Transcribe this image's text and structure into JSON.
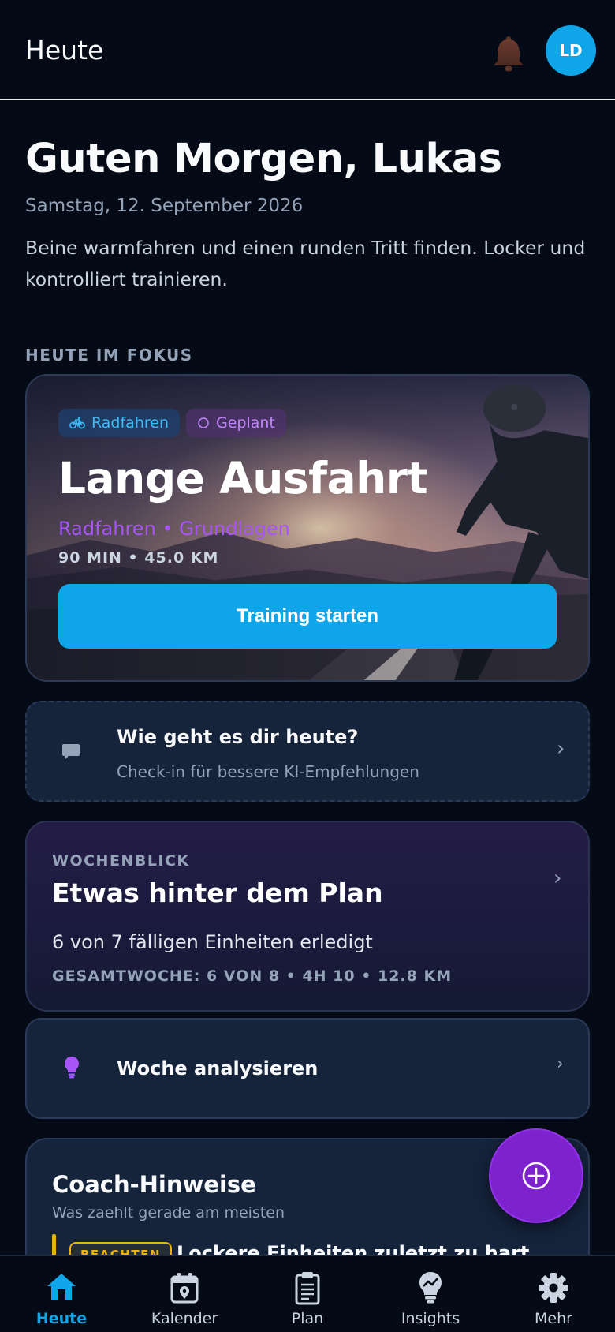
{
  "header": {
    "title": "Heute",
    "avatar_initials": "LD"
  },
  "greeting": {
    "title": "Guten Morgen, Lukas",
    "date": "Samstag, 12. September 2026",
    "intro": "Beine warmfahren und einen runden Tritt finden. Locker und kontrolliert trainieren."
  },
  "focus": {
    "section_label": "HEUTE IM FOKUS",
    "sport_chip": "Radfahren",
    "status_chip": "Geplant",
    "title": "Lange Ausfahrt",
    "subtitle": "Radfahren • Grundlagen",
    "meta": "90 MIN • 45.0 KM",
    "start_label": "Training starten"
  },
  "checkin": {
    "title": "Wie geht es dir heute?",
    "subtitle": "Check-in für bessere KI-Empfehlungen"
  },
  "week": {
    "label": "WOCHENBLICK",
    "title": "Etwas hinter dem Plan",
    "line": "6 von 7 fälligen Einheiten erledigt",
    "meta": "GESAMTWOCHE: 6 VON 8 • 4H 10 • 12.8 KM"
  },
  "analyse": {
    "title": "Woche analysieren"
  },
  "coach": {
    "title": "Coach-Hinweise",
    "subtitle": "Was zaehlt gerade am meisten",
    "badge": "BEACHTEN",
    "note": "Lockere Einheiten zuletzt zu hart"
  },
  "nav": {
    "items": [
      {
        "label": "Heute",
        "icon": "home-icon"
      },
      {
        "label": "Kalender",
        "icon": "calendar-icon"
      },
      {
        "label": "Plan",
        "icon": "clipboard-icon"
      },
      {
        "label": "Insights",
        "icon": "lightbulb-icon"
      },
      {
        "label": "Mehr",
        "icon": "gear-icon"
      }
    ],
    "active": "Heute"
  },
  "colors": {
    "accent": "#0ea5e9",
    "purple": "#a855f7",
    "fab": "#7e22ce",
    "warning": "#eab308",
    "background": "#040b16",
    "card": "#15233b"
  }
}
